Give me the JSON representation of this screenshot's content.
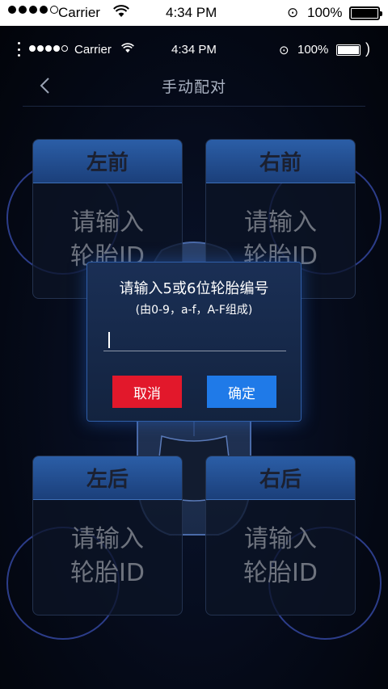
{
  "outer_status": {
    "carrier": "Carrier",
    "time": "4:34 PM",
    "battery": "100%"
  },
  "inner_status": {
    "carrier": "Carrier",
    "time": "4:34 PM",
    "battery": "100%"
  },
  "navbar": {
    "title": "手动配对",
    "back_icon": "chevron-left-icon"
  },
  "tires": [
    {
      "position": "左前",
      "placeholder": "请输入\n轮胎ID"
    },
    {
      "position": "右前",
      "placeholder": "请输入\n轮胎ID"
    },
    {
      "position": "左后",
      "placeholder": "请输入\n轮胎ID"
    },
    {
      "position": "右后",
      "placeholder": "请输入\n轮胎ID"
    }
  ],
  "dialog": {
    "title": "请输入5或6位轮胎编号",
    "subtitle": "(由0-9，a-f，A-F组成)",
    "input_value": "",
    "cancel_label": "取消",
    "ok_label": "确定"
  },
  "colors": {
    "tire_header": "#2b5ea7",
    "cancel": "#e2182b",
    "ok": "#1f7ae8"
  }
}
